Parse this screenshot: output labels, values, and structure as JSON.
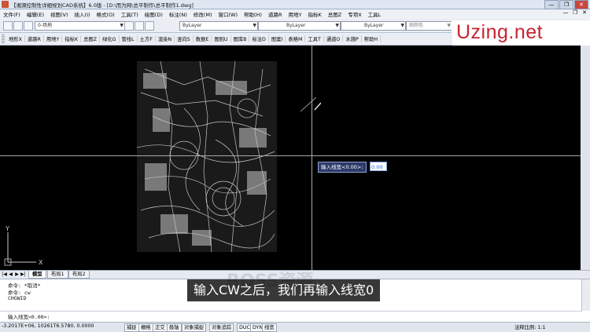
{
  "window": {
    "title": "【湘源控制性详细规划CAD系统】6.0版 - [D:\\而为网\\总平制作\\总平制作1.dwg]",
    "buttons": [
      "—",
      "❐",
      "✕"
    ]
  },
  "menubar": {
    "items": [
      "文件(F)",
      "编辑(E)",
      "视图(V)",
      "插入(I)",
      "格式(O)",
      "工具(T)",
      "绘图(D)",
      "标注(N)",
      "修改(M)",
      "窗口(W)",
      "帮助(H)",
      "道路R",
      "用地Y",
      "指标K",
      "总图Z",
      "专项X",
      "工具L"
    ],
    "mdi_buttons": [
      "—",
      "❐",
      "✕"
    ]
  },
  "toolbar1": {
    "layer_value": "0-场地",
    "color_value": "ByLayer",
    "linetype_value": "ByLayer",
    "lineweight_value": "ByLayer",
    "plotstyle_value": "随颜色"
  },
  "toolbar2": {
    "items": [
      "地形X",
      "道路R",
      "用地Y",
      "指标K",
      "总图Z",
      "绿化G",
      "管线L",
      "土方F",
      "渲染N",
      "竖向S",
      "数据E",
      "图则U",
      "图库B",
      "标注D",
      "图案I",
      "表格M",
      "工具T",
      "通道O",
      "水施P",
      "帮助H"
    ]
  },
  "logo": {
    "text": "Uzing.net"
  },
  "drawing": {
    "prompt_label": "输入线宽<0.00>:",
    "prompt_value": "0.00",
    "ucs_x": "X",
    "ucs_y": "Y"
  },
  "tabs": {
    "nav": [
      "|◀",
      "◀",
      "▶",
      "▶|"
    ],
    "items": [
      "模型",
      "布局1",
      "布局2"
    ]
  },
  "command": {
    "lines": [
      "命令: *取消*",
      "命令: cw",
      "CHGWID"
    ],
    "input": "输入线宽<0.00>:"
  },
  "subtitle": "输入CW之后，我们再输入线宽0",
  "watermark": "ROSS资源",
  "statusbar": {
    "coords": "-3.2017E+06, 10261T6.5780, 0.0000",
    "toggles": [
      "捕捉",
      "栅格",
      "正交",
      "极轴",
      "对象捕捉",
      "对象追踪",
      "DUCS",
      "DYN",
      "线宽"
    ],
    "annotation_scale_label": "注释比例:",
    "annotation_scale_value": "1:1"
  },
  "colors": {
    "accent": "#c8242f",
    "canvas": "#000000",
    "chrome": "#eaeef4"
  }
}
